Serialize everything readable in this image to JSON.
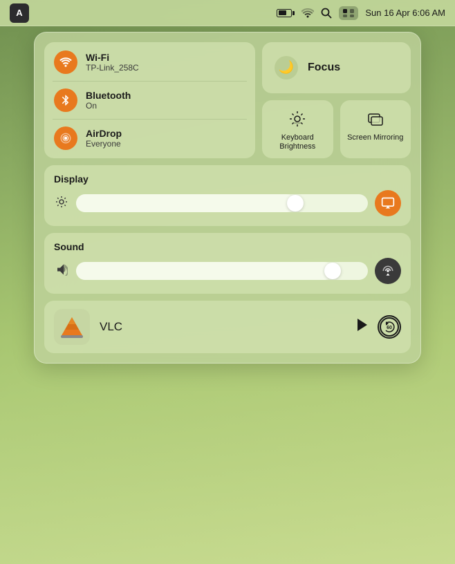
{
  "menubar": {
    "avatar_label": "A",
    "time": "Sun 16 Apr  6:06 AM",
    "battery_pct": 65
  },
  "connectivity": {
    "wifi": {
      "name": "Wi-Fi",
      "network": "TP-Link_258C"
    },
    "bluetooth": {
      "name": "Bluetooth",
      "status": "On"
    },
    "airdrop": {
      "name": "AirDrop",
      "status": "Everyone"
    }
  },
  "focus": {
    "label": "Focus"
  },
  "tiles": {
    "keyboard": {
      "label": "Keyboard\nBrightness"
    },
    "screen_mirroring": {
      "label": "Screen\nMirroring"
    }
  },
  "display": {
    "label": "Display",
    "value": 75
  },
  "sound": {
    "label": "Sound",
    "value": 90
  },
  "vlc": {
    "name": "VLC",
    "skip_label": "60"
  }
}
